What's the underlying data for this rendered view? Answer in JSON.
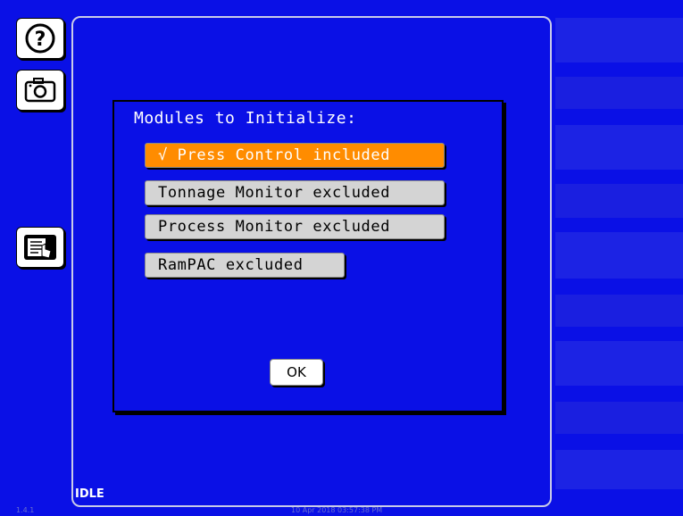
{
  "sidebar": {
    "help_icon": "question-circle-icon",
    "camera_icon": "camera-icon",
    "screen_icon": "touch-screen-icon"
  },
  "dialog": {
    "title": "Modules to Initialize:",
    "modules": [
      {
        "label": "√ Press Control included",
        "state": "included"
      },
      {
        "label": "Tonnage Monitor excluded",
        "state": "excluded"
      },
      {
        "label": "Process Monitor excluded",
        "state": "excluded"
      },
      {
        "label": "RamPAC excluded",
        "state": "excluded"
      }
    ],
    "ok_label": "OK"
  },
  "status": {
    "mode": "IDLE",
    "version": "1.4.1",
    "datetime": "10 Apr 2018 03:57:38 PM"
  },
  "colors": {
    "background": "#0a10e6",
    "included": "#ff8c00",
    "excluded": "#d4d4d4"
  }
}
